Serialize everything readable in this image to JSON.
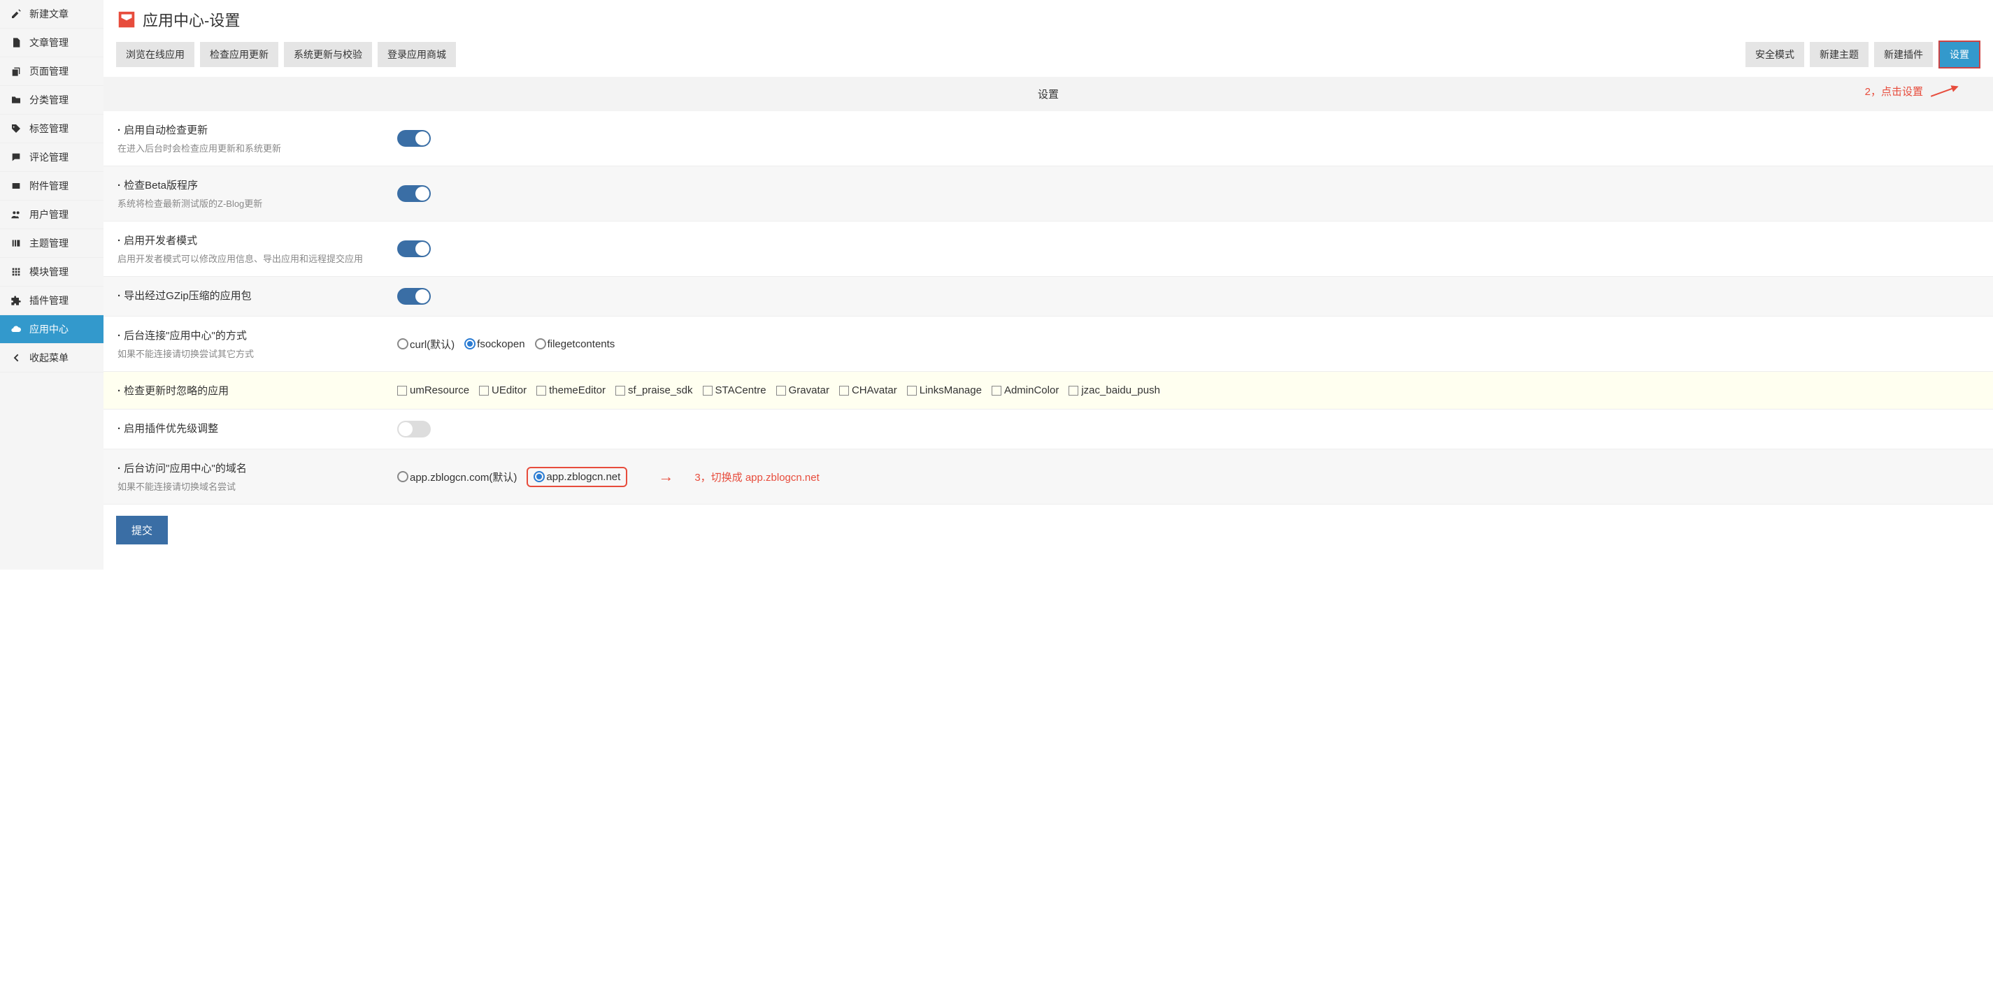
{
  "sidebar": {
    "items": [
      {
        "label": "新建文章",
        "icon": "pencil-icon"
      },
      {
        "label": "文章管理",
        "icon": "file-text-icon"
      },
      {
        "label": "页面管理",
        "icon": "copy-icon"
      },
      {
        "label": "分类管理",
        "icon": "folder-icon"
      },
      {
        "label": "标签管理",
        "icon": "tag-icon"
      },
      {
        "label": "评论管理",
        "icon": "comment-icon"
      },
      {
        "label": "附件管理",
        "icon": "attachment-icon"
      },
      {
        "label": "用户管理",
        "icon": "users-icon"
      },
      {
        "label": "主题管理",
        "icon": "bars-icon"
      },
      {
        "label": "模块管理",
        "icon": "grid-icon"
      },
      {
        "label": "插件管理",
        "icon": "puzzle-icon"
      },
      {
        "label": "应用中心",
        "icon": "cloud-icon",
        "active": true
      },
      {
        "label": "收起菜单",
        "icon": "chevron-left-icon"
      }
    ]
  },
  "header": {
    "title": "应用中心-设置"
  },
  "toolbar": {
    "left": [
      {
        "label": "浏览在线应用"
      },
      {
        "label": "检查应用更新"
      },
      {
        "label": "系统更新与校验"
      },
      {
        "label": "登录应用商城"
      }
    ],
    "right": [
      {
        "label": "安全模式"
      },
      {
        "label": "新建主题"
      },
      {
        "label": "新建插件"
      },
      {
        "label": "设置",
        "primary": true
      }
    ]
  },
  "settings_header": "设置",
  "annotation_1": "2，点击设置",
  "settings": [
    {
      "title": "启用自动检查更新",
      "desc": "在进入后台时会检查应用更新和系统更新",
      "type": "toggle",
      "value": true,
      "alt": false
    },
    {
      "title": "检查Beta版程序",
      "desc": "系统将检查最新测试版的Z-Blog更新",
      "type": "toggle",
      "value": true,
      "alt": true
    },
    {
      "title": "启用开发者模式",
      "desc": "启用开发者模式可以修改应用信息、导出应用和远程提交应用",
      "type": "toggle",
      "value": true,
      "alt": false
    },
    {
      "title": "导出经过GZip压缩的应用包",
      "desc": "",
      "type": "toggle",
      "value": true,
      "alt": true
    },
    {
      "title": "后台连接\"应用中心\"的方式",
      "desc": "如果不能连接请切换尝试其它方式",
      "type": "radio",
      "options": [
        "curl(默认)",
        "fsockopen",
        "filegetcontents"
      ],
      "selected": 1,
      "alt": false
    },
    {
      "title": "检查更新时忽略的应用",
      "desc": "",
      "type": "checklist",
      "options": [
        "umResource",
        "UEditor",
        "themeEditor",
        "sf_praise_sdk",
        "STACentre",
        "Gravatar",
        "CHAvatar",
        "LinksManage",
        "AdminColor",
        "jzac_baidu_push"
      ],
      "highlight": true
    },
    {
      "title": "启用插件优先级调整",
      "desc": "",
      "type": "toggle",
      "value": false,
      "alt": false
    },
    {
      "title": "后台访问\"应用中心\"的域名",
      "desc": "如果不能连接请切换域名尝试",
      "type": "radio",
      "options": [
        "app.zblogcn.com(默认)",
        "app.zblogcn.net"
      ],
      "selected": 1,
      "alt": true,
      "annotation": true
    }
  ],
  "annotation_2": "3，切换成 app.zblogcn.net",
  "submit_label": "提交"
}
